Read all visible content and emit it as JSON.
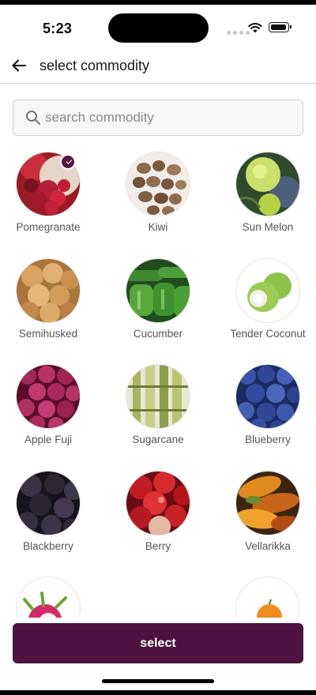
{
  "status_bar": {
    "time": "5:23"
  },
  "header": {
    "title": "select commodity"
  },
  "search": {
    "placeholder": "search commodity",
    "value": ""
  },
  "commodities": [
    {
      "label": "Pomegranate",
      "selected": true
    },
    {
      "label": "Kiwi",
      "selected": false
    },
    {
      "label": "Sun Melon",
      "selected": false
    },
    {
      "label": "Semihusked",
      "selected": false
    },
    {
      "label": "Cucumber",
      "selected": false
    },
    {
      "label": "Tender Coconut",
      "selected": false
    },
    {
      "label": "Apple Fuji",
      "selected": false
    },
    {
      "label": "Sugarcane",
      "selected": false
    },
    {
      "label": "Blueberry",
      "selected": false
    },
    {
      "label": "Blackberry",
      "selected": false
    },
    {
      "label": "Berry",
      "selected": false
    },
    {
      "label": "Vellarikka",
      "selected": false
    }
  ],
  "footer": {
    "select_label": "select"
  },
  "colors": {
    "accent": "#4d1240",
    "border": "#cfcfcf",
    "label": "#555555"
  }
}
